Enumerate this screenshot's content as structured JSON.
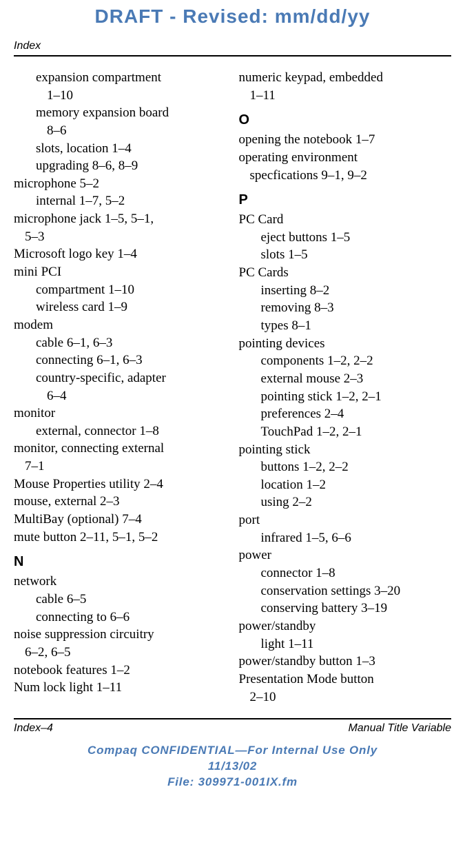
{
  "draft_header": "DRAFT - Revised: mm/dd/yy",
  "page_header": "Index",
  "col1": [
    {
      "cls": "ent-sub",
      "t": "expansion compartment"
    },
    {
      "cls": "ent-subsub",
      "t": "1–10"
    },
    {
      "cls": "ent-sub",
      "t": "memory expansion board"
    },
    {
      "cls": "ent-subsub",
      "t": "8–6"
    },
    {
      "cls": "ent-sub",
      "t": "slots, location 1–4"
    },
    {
      "cls": "ent-sub",
      "t": "upgrading 8–6, 8–9"
    },
    {
      "cls": "ent-top",
      "t": "microphone 5–2"
    },
    {
      "cls": "ent-sub",
      "t": "internal 1–7, 5–2"
    },
    {
      "cls": "ent-top",
      "t": "microphone jack 1–5, 5–1,"
    },
    {
      "cls": "ent-cont",
      "t": "5–3"
    },
    {
      "cls": "ent-top",
      "t": "Microsoft logo key 1–4"
    },
    {
      "cls": "ent-top",
      "t": "mini PCI"
    },
    {
      "cls": "ent-sub",
      "t": "compartment 1–10"
    },
    {
      "cls": "ent-sub",
      "t": "wireless card 1–9"
    },
    {
      "cls": "ent-top",
      "t": "modem"
    },
    {
      "cls": "ent-sub",
      "t": "cable 6–1, 6–3"
    },
    {
      "cls": "ent-sub",
      "t": "connecting 6–1, 6–3"
    },
    {
      "cls": "ent-sub",
      "t": "country-specific, adapter"
    },
    {
      "cls": "ent-subsub",
      "t": "6–4"
    },
    {
      "cls": "ent-top",
      "t": "monitor"
    },
    {
      "cls": "ent-sub",
      "t": "external, connector 1–8"
    },
    {
      "cls": "ent-top",
      "t": "monitor, connecting external"
    },
    {
      "cls": "ent-cont",
      "t": "7–1"
    },
    {
      "cls": "ent-top",
      "t": "Mouse Properties utility 2–4"
    },
    {
      "cls": "ent-top",
      "t": "mouse, external 2–3"
    },
    {
      "cls": "ent-top",
      "t": "MultiBay (optional) 7–4"
    },
    {
      "cls": "ent-top",
      "t": "mute button 2–11, 5–1, 5–2"
    },
    {
      "cls": "letter-head",
      "t": "N"
    },
    {
      "cls": "ent-top",
      "t": "network"
    },
    {
      "cls": "ent-sub",
      "t": "cable 6–5"
    },
    {
      "cls": "ent-sub",
      "t": "connecting to 6–6"
    },
    {
      "cls": "ent-top",
      "t": "noise suppression circuitry"
    },
    {
      "cls": "ent-cont",
      "t": "6–2, 6–5"
    },
    {
      "cls": "ent-top",
      "t": "notebook features 1–2"
    },
    {
      "cls": "ent-top",
      "t": "Num lock light 1–11"
    }
  ],
  "col2": [
    {
      "cls": "ent-top",
      "t": "numeric keypad, embedded"
    },
    {
      "cls": "ent-cont",
      "t": "1–11"
    },
    {
      "cls": "letter-head",
      "t": "O"
    },
    {
      "cls": "ent-top",
      "t": "opening the notebook 1–7"
    },
    {
      "cls": "ent-top",
      "t": "operating environment"
    },
    {
      "cls": "ent-cont",
      "t": "specfications 9–1, 9–2"
    },
    {
      "cls": "letter-head",
      "t": "P"
    },
    {
      "cls": "ent-top",
      "t": "PC Card"
    },
    {
      "cls": "ent-sub",
      "t": "eject buttons 1–5"
    },
    {
      "cls": "ent-sub",
      "t": "slots 1–5"
    },
    {
      "cls": "ent-top",
      "t": "PC Cards"
    },
    {
      "cls": "ent-sub",
      "t": "inserting 8–2"
    },
    {
      "cls": "ent-sub",
      "t": "removing 8–3"
    },
    {
      "cls": "ent-sub",
      "t": "types 8–1"
    },
    {
      "cls": "ent-top",
      "t": "pointing devices"
    },
    {
      "cls": "ent-sub",
      "t": "components 1–2, 2–2"
    },
    {
      "cls": "ent-sub",
      "t": "external mouse 2–3"
    },
    {
      "cls": "ent-sub",
      "t": "pointing stick 1–2, 2–1"
    },
    {
      "cls": "ent-sub",
      "t": "preferences 2–4"
    },
    {
      "cls": "ent-sub",
      "t": "TouchPad 1–2, 2–1"
    },
    {
      "cls": "ent-top",
      "t": "pointing stick"
    },
    {
      "cls": "ent-sub",
      "t": "buttons 1–2, 2–2"
    },
    {
      "cls": "ent-sub",
      "t": "location 1–2"
    },
    {
      "cls": "ent-sub",
      "t": "using 2–2"
    },
    {
      "cls": "ent-top",
      "t": "port"
    },
    {
      "cls": "ent-sub",
      "t": "infrared 1–5, 6–6"
    },
    {
      "cls": "ent-top",
      "t": "power"
    },
    {
      "cls": "ent-sub",
      "t": "connector 1–8"
    },
    {
      "cls": "ent-sub",
      "t": "conservation settings 3–20"
    },
    {
      "cls": "ent-sub",
      "t": "conserving battery 3–19"
    },
    {
      "cls": "ent-top",
      "t": "power/standby"
    },
    {
      "cls": "ent-sub",
      "t": "light 1–11"
    },
    {
      "cls": "ent-top",
      "t": "power/standby button 1–3"
    },
    {
      "cls": "ent-top",
      "t": "Presentation Mode button"
    },
    {
      "cls": "ent-cont",
      "t": "2–10"
    }
  ],
  "footer_left": "Index–4",
  "footer_right": "Manual Title Variable",
  "conf1": "Compaq CONFIDENTIAL—For Internal Use Only",
  "conf2": "11/13/02",
  "conf3": "File: 309971-001IX.fm"
}
